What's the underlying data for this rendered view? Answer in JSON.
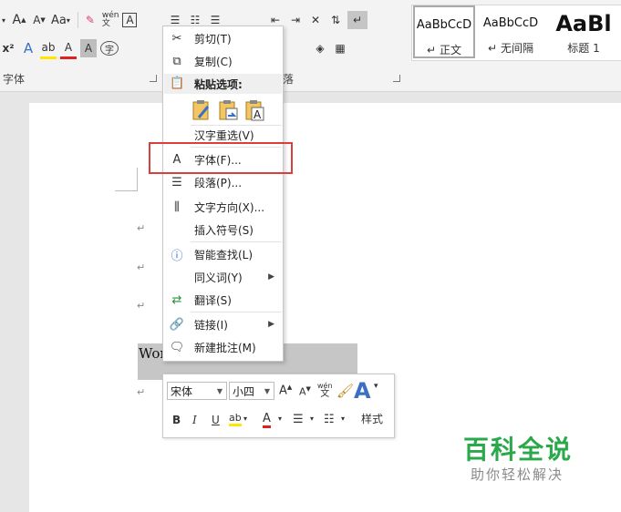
{
  "ribbon": {
    "font_group_label": "字体",
    "paragraph_group_label": "落",
    "row1_font": [
      "A",
      "A",
      "Aa",
      "wén\n文",
      "A"
    ],
    "row2_font": [
      "x²",
      "A",
      "ab",
      "A",
      "A",
      "字"
    ],
    "styles": [
      {
        "preview": "AaBbCcD",
        "name": "正文",
        "prefix": "↵"
      },
      {
        "preview": "AaBbCcD",
        "name": "无间隔",
        "prefix": "↵"
      },
      {
        "preview": "AaBl",
        "name": "标题 1",
        "prefix": ""
      }
    ]
  },
  "document": {
    "selected_text": "Word       调的更大",
    "paragraph_mark": "↵"
  },
  "context_menu": {
    "items": [
      {
        "label": "剪切(T)",
        "icon": "scissors-icon"
      },
      {
        "label": "复制(C)",
        "icon": "copy-icon"
      },
      {
        "label": "汉字重选(V)",
        "icon": ""
      },
      {
        "label": "字体(F)...",
        "icon": "font-icon"
      },
      {
        "label": "段落(P)...",
        "icon": "paragraph-icon"
      },
      {
        "label": "文字方向(X)...",
        "icon": "text-direction-icon"
      },
      {
        "label": "插入符号(S)",
        "icon": ""
      },
      {
        "label": "智能查找(L)",
        "icon": "smart-lookup-icon"
      },
      {
        "label": "同义词(Y)",
        "icon": ""
      },
      {
        "label": "翻译(S)",
        "icon": "translate-icon"
      },
      {
        "label": "链接(I)",
        "icon": "link-icon"
      },
      {
        "label": "新建批注(M)",
        "icon": "comment-icon"
      }
    ],
    "paste_header": "粘贴选项:"
  },
  "mini_toolbar": {
    "font_name": "宋体",
    "font_size": "小四",
    "styles_label": "样式",
    "buttons": [
      "B",
      "I",
      "U"
    ]
  },
  "watermark": {
    "title": "百科全说",
    "subtitle": "助你轻松解决"
  },
  "colors": {
    "highlight_border": "#d9403d",
    "watermark_green": "#2aa84a",
    "selection_gray": "#c6c6c6"
  }
}
